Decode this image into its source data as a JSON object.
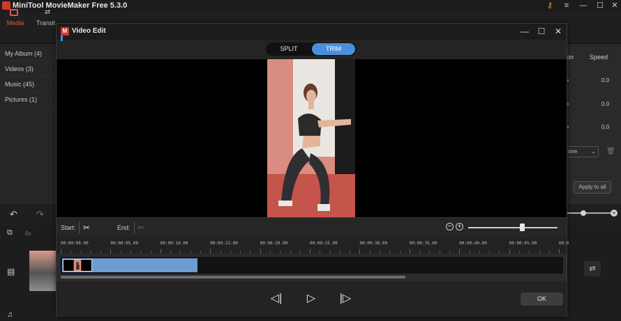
{
  "app": {
    "title": "MiniTool MovieMaker Free 5.3.0",
    "tabs": [
      {
        "label": "Media",
        "active": true
      },
      {
        "label": "Transit",
        "active": false
      }
    ],
    "library": [
      {
        "label": "My Album (4)"
      },
      {
        "label": "Videos (3)"
      },
      {
        "label": "Music (45)"
      },
      {
        "label": "Pictures (1)"
      }
    ],
    "right_panel": {
      "tab_partial": "on",
      "speed_tab": "Speed",
      "values": [
        "0.0",
        "0.0",
        "0.0"
      ],
      "select_partial": "one",
      "apply_label": "Apply to all"
    },
    "timeline_partial_label": "0s"
  },
  "dialog": {
    "title": "Video Edit",
    "modes": {
      "split": "SPLIT",
      "trim": "TRIM",
      "active": "TRIM"
    },
    "start_label": "Start:",
    "end_label": "End:",
    "zoom_level": 0.6,
    "ruler_ticks": [
      "00:00:00.00",
      "00:00:05.00",
      "00:00:10.00",
      "00:00:15.00",
      "00:00:20.00",
      "00:00:25.00",
      "00:00:30.00",
      "00:00:35.00",
      "00:00:40.00",
      "00:00:45.00",
      "00:0"
    ],
    "ok_label": "OK",
    "accent_color": "#4a8fdc",
    "brand_color": "#d4372c"
  },
  "icons": {
    "minimize": "minimize-icon",
    "maximize": "maximize-icon",
    "close": "close-icon",
    "key": "key-icon",
    "menu": "menu-icon",
    "scissors": "scissors-icon",
    "zoom_out": "zoom-out-icon",
    "zoom_in": "zoom-in-icon",
    "prev_frame": "previous-frame-icon",
    "play": "play-icon",
    "next_frame": "next-frame-icon"
  }
}
